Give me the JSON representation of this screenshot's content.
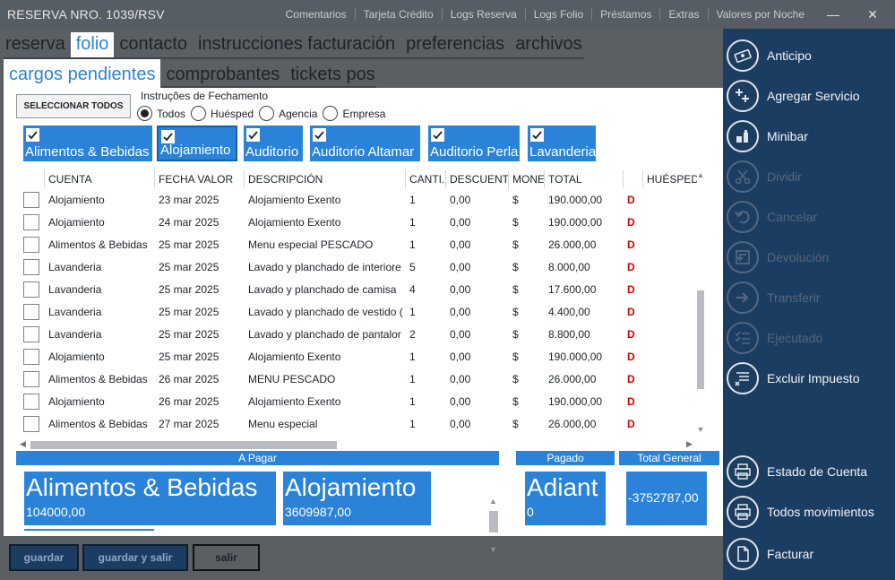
{
  "window": {
    "title": "RESERVA NRO. 1039/RSV",
    "menu": [
      "Comentarios",
      "Tarjeta Crédito",
      "Logs Reserva",
      "Logs Folio",
      "Préstamos",
      "Extras",
      "Valores por Noche"
    ],
    "minimize": "—",
    "close": "✕"
  },
  "tabs": [
    "reserva",
    "folio",
    "contacto",
    "instrucciones facturación",
    "preferencias",
    "archivos"
  ],
  "subtabs": [
    "cargos pendientes",
    "comprobantes",
    "tickets pos"
  ],
  "select_all_label": "SELECCIONAR TODOS",
  "closing_instructions": {
    "label": "Instruções de Fechamento",
    "options": [
      "Todos",
      "Huésped",
      "Agencia",
      "Empresa"
    ],
    "selected": "Todos"
  },
  "categories": [
    {
      "label": "Alimentos & Bebidas",
      "checked": true
    },
    {
      "label": "Alojamiento",
      "checked": true
    },
    {
      "label": "Auditorio",
      "checked": true
    },
    {
      "label": "Auditorio Altamar",
      "checked": true
    },
    {
      "label": "Auditorio Perla",
      "checked": true
    },
    {
      "label": "Lavanderia",
      "checked": true
    }
  ],
  "table": {
    "columns": [
      "CUENTA",
      "FECHA VALOR",
      "DESCRIPCIÓN",
      "CANTI.",
      "DESCUENTO",
      "MONE",
      "TOTAL",
      "",
      "HUÉSPED"
    ],
    "rows": [
      {
        "cuenta": "Alojamiento",
        "fecha": "23 mar 2025",
        "desc": "Alojamiento Exento",
        "cant": "1",
        "descuento": "0,00",
        "moneda": "$",
        "total": "190.000,00",
        "flag": "D"
      },
      {
        "cuenta": "Alojamiento",
        "fecha": "24 mar 2025",
        "desc": "Alojamiento Exento",
        "cant": "1",
        "descuento": "0,00",
        "moneda": "$",
        "total": "190.000,00",
        "flag": "D"
      },
      {
        "cuenta": "Alimentos & Bebidas",
        "fecha": "25 mar 2025",
        "desc": "Menu especial PESCADO",
        "cant": "1",
        "descuento": "0,00",
        "moneda": "$",
        "total": "26.000,00",
        "flag": "D"
      },
      {
        "cuenta": "Lavanderia",
        "fecha": "25 mar 2025",
        "desc": "Lavado y planchado de interiore",
        "cant": "5",
        "descuento": "0,00",
        "moneda": "$",
        "total": "8.000,00",
        "flag": "D"
      },
      {
        "cuenta": "Lavanderia",
        "fecha": "25 mar 2025",
        "desc": "Lavado y planchado de camisa",
        "cant": "4",
        "descuento": "0,00",
        "moneda": "$",
        "total": "17.600,00",
        "flag": "D"
      },
      {
        "cuenta": "Lavanderia",
        "fecha": "25 mar 2025",
        "desc": "Lavado y planchado de vestido (",
        "cant": "1",
        "descuento": "0,00",
        "moneda": "$",
        "total": "4.400,00",
        "flag": "D"
      },
      {
        "cuenta": "Lavanderia",
        "fecha": "25 mar 2025",
        "desc": "Lavado y planchado de pantalor",
        "cant": "2",
        "descuento": "0,00",
        "moneda": "$",
        "total": "8.800,00",
        "flag": "D"
      },
      {
        "cuenta": "Alojamiento",
        "fecha": "25 mar 2025",
        "desc": "Alojamiento Exento",
        "cant": "1",
        "descuento": "0,00",
        "moneda": "$",
        "total": "190.000,00",
        "flag": "D"
      },
      {
        "cuenta": "Alimentos & Bebidas",
        "fecha": "26 mar 2025",
        "desc": "MENU PESCADO",
        "cant": "1",
        "descuento": "0,00",
        "moneda": "$",
        "total": "26.000,00",
        "flag": "D"
      },
      {
        "cuenta": "Alojamiento",
        "fecha": "26 mar 2025",
        "desc": "Alojamiento Exento",
        "cant": "1",
        "descuento": "0,00",
        "moneda": "$",
        "total": "190.000,00",
        "flag": "D"
      },
      {
        "cuenta": "Alimentos & Bebidas",
        "fecha": "27 mar 2025",
        "desc": "Menu especial",
        "cant": "1",
        "descuento": "0,00",
        "moneda": "$",
        "total": "26.000,00",
        "flag": "D"
      }
    ]
  },
  "summary": {
    "a_pagar_label": "A Pagar",
    "pagado_label": "Pagado",
    "total_general_label": "Total General",
    "a_pagar": [
      {
        "name": "Alimentos & Bebidas",
        "amount": "104000,00"
      },
      {
        "name": "Alojamiento",
        "amount": "3609987,00"
      }
    ],
    "pagado": {
      "name": "Adiant",
      "amount": "0"
    },
    "total_general": "-3752787,00"
  },
  "bottom_buttons": [
    "guardar",
    "guardar y salir",
    "salir"
  ],
  "sidebar": [
    {
      "label": "Anticipo",
      "icon": "cash-icon",
      "enabled": true
    },
    {
      "label": "Agregar Servicio",
      "icon": "add-service-icon",
      "enabled": true
    },
    {
      "label": "Minibar",
      "icon": "minibar-icon",
      "enabled": true
    },
    {
      "label": "Dividir",
      "icon": "scissors-icon",
      "enabled": false
    },
    {
      "label": "Cancelar",
      "icon": "undo-icon",
      "enabled": false
    },
    {
      "label": "Devolución",
      "icon": "return-icon",
      "enabled": false
    },
    {
      "label": "Transferir",
      "icon": "arrow-right-icon",
      "enabled": false
    },
    {
      "label": "Ejecutado",
      "icon": "checklist-icon",
      "enabled": false
    },
    {
      "label": "Excluir Impuesto",
      "icon": "exclude-tax-icon",
      "enabled": true
    },
    {
      "label": "Estado de Cuenta",
      "icon": "printer-icon",
      "enabled": true
    },
    {
      "label": "Todos movimientos",
      "icon": "printer-icon",
      "enabled": true
    },
    {
      "label": "Facturar",
      "icon": "document-icon",
      "enabled": true
    }
  ]
}
